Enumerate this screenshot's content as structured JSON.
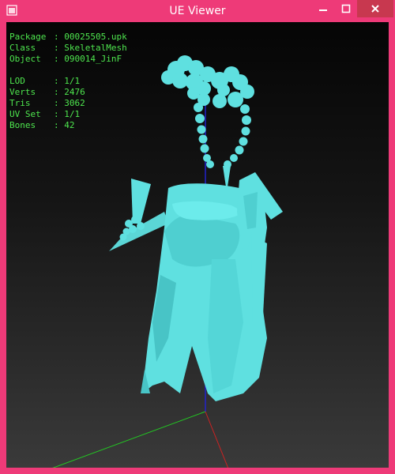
{
  "window": {
    "title": "UE Viewer",
    "frame_color": "#ee3a78",
    "buttons": {
      "minimize": "minimize-icon",
      "maximize": "maximize-icon",
      "close": "close-icon"
    }
  },
  "info": {
    "rows_top": [
      {
        "label": "Package",
        "sep": ":",
        "value": "00025505.upk"
      },
      {
        "label": "Class",
        "sep": ":",
        "value": "SkeletalMesh"
      },
      {
        "label": "Object",
        "sep": ":",
        "value": "090014_JinF"
      }
    ],
    "rows_bottom": [
      {
        "label": "LOD",
        "sep": ":",
        "value": "1/1"
      },
      {
        "label": "Verts",
        "sep": ":",
        "value": "2476"
      },
      {
        "label": "Tris",
        "sep": ":",
        "value": "3062"
      },
      {
        "label": "UV Set",
        "sep": ":",
        "value": "1/1"
      },
      {
        "label": "Bones",
        "sep": ":",
        "value": "42"
      }
    ],
    "color": "#4ee64e"
  },
  "scene": {
    "mesh_color": "#5fe0e0",
    "axis_colors": {
      "x": "#cc2222",
      "y": "#22cc22",
      "z": "#2222cc"
    }
  }
}
